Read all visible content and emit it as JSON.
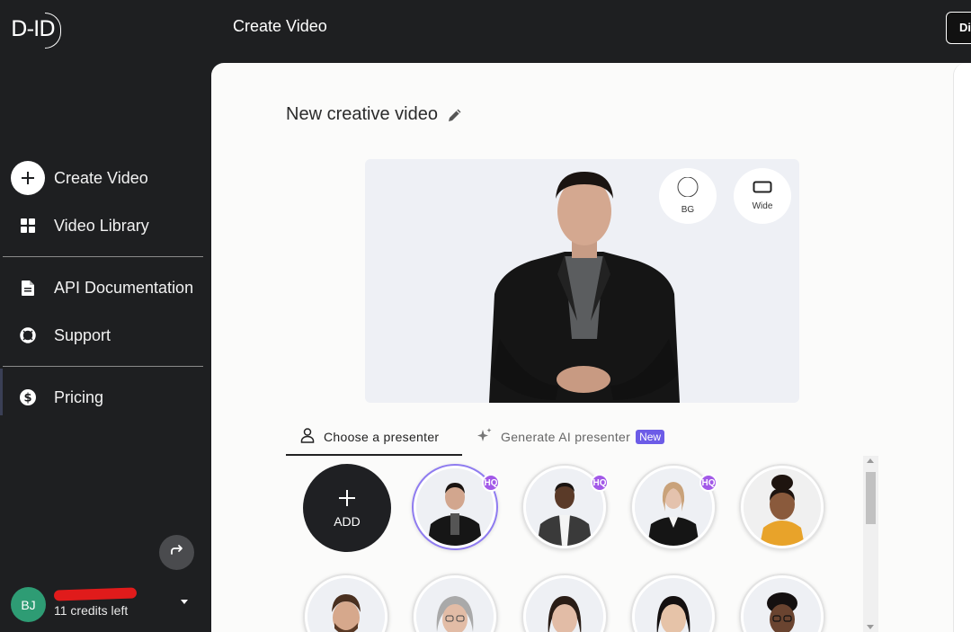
{
  "app": {
    "logo_text": "D-ID",
    "page_title": "Create Video",
    "top_right_button": "Di"
  },
  "sidebar": {
    "items": [
      {
        "label": "Create Video",
        "icon": "plus-circle-icon"
      },
      {
        "label": "Video Library",
        "icon": "grid-icon"
      },
      {
        "label": "API Documentation",
        "icon": "document-icon"
      },
      {
        "label": "Support",
        "icon": "lifebuoy-icon"
      },
      {
        "label": "Pricing",
        "icon": "dollar-circle-icon"
      }
    ],
    "user": {
      "initials": "BJ",
      "credits": "11 credits left"
    }
  },
  "main": {
    "video_title": "New creative video",
    "preview_options": [
      {
        "label": "BG",
        "icon": "circle-icon"
      },
      {
        "label": "Wide",
        "icon": "rectangle-icon"
      }
    ],
    "tabs": [
      {
        "label": "Choose a presenter",
        "icon": "person-icon",
        "active": true
      },
      {
        "label": "Generate AI presenter",
        "icon": "sparkle-icon",
        "badge": "New",
        "active": false
      }
    ],
    "add_label": "ADD",
    "hq_badge": "HQ"
  },
  "colors": {
    "sidebar_bg": "#1e1f21",
    "avatar_bg": "#2e9c74",
    "hq_badge": "#a259e8",
    "new_badge": "#6c5ce7",
    "selected_ring": "#8f7cf0"
  }
}
